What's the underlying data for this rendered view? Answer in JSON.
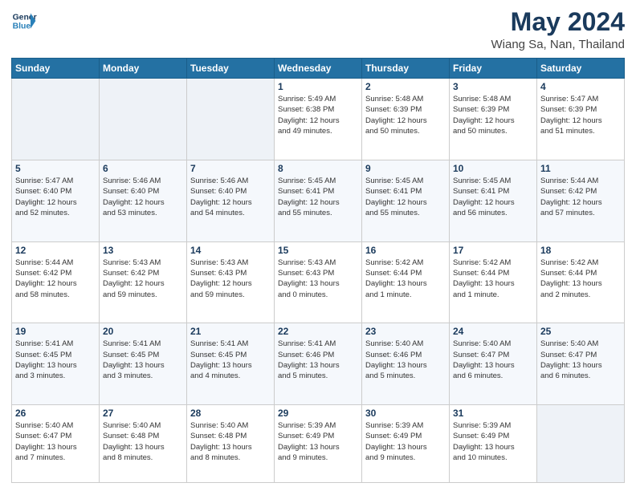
{
  "header": {
    "logo_line1": "General",
    "logo_line2": "Blue",
    "month": "May 2024",
    "location": "Wiang Sa, Nan, Thailand"
  },
  "weekdays": [
    "Sunday",
    "Monday",
    "Tuesday",
    "Wednesday",
    "Thursday",
    "Friday",
    "Saturday"
  ],
  "weeks": [
    [
      {
        "day": "",
        "info": ""
      },
      {
        "day": "",
        "info": ""
      },
      {
        "day": "",
        "info": ""
      },
      {
        "day": "1",
        "info": "Sunrise: 5:49 AM\nSunset: 6:38 PM\nDaylight: 12 hours\nand 49 minutes."
      },
      {
        "day": "2",
        "info": "Sunrise: 5:48 AM\nSunset: 6:39 PM\nDaylight: 12 hours\nand 50 minutes."
      },
      {
        "day": "3",
        "info": "Sunrise: 5:48 AM\nSunset: 6:39 PM\nDaylight: 12 hours\nand 50 minutes."
      },
      {
        "day": "4",
        "info": "Sunrise: 5:47 AM\nSunset: 6:39 PM\nDaylight: 12 hours\nand 51 minutes."
      }
    ],
    [
      {
        "day": "5",
        "info": "Sunrise: 5:47 AM\nSunset: 6:40 PM\nDaylight: 12 hours\nand 52 minutes."
      },
      {
        "day": "6",
        "info": "Sunrise: 5:46 AM\nSunset: 6:40 PM\nDaylight: 12 hours\nand 53 minutes."
      },
      {
        "day": "7",
        "info": "Sunrise: 5:46 AM\nSunset: 6:40 PM\nDaylight: 12 hours\nand 54 minutes."
      },
      {
        "day": "8",
        "info": "Sunrise: 5:45 AM\nSunset: 6:41 PM\nDaylight: 12 hours\nand 55 minutes."
      },
      {
        "day": "9",
        "info": "Sunrise: 5:45 AM\nSunset: 6:41 PM\nDaylight: 12 hours\nand 55 minutes."
      },
      {
        "day": "10",
        "info": "Sunrise: 5:45 AM\nSunset: 6:41 PM\nDaylight: 12 hours\nand 56 minutes."
      },
      {
        "day": "11",
        "info": "Sunrise: 5:44 AM\nSunset: 6:42 PM\nDaylight: 12 hours\nand 57 minutes."
      }
    ],
    [
      {
        "day": "12",
        "info": "Sunrise: 5:44 AM\nSunset: 6:42 PM\nDaylight: 12 hours\nand 58 minutes."
      },
      {
        "day": "13",
        "info": "Sunrise: 5:43 AM\nSunset: 6:42 PM\nDaylight: 12 hours\nand 59 minutes."
      },
      {
        "day": "14",
        "info": "Sunrise: 5:43 AM\nSunset: 6:43 PM\nDaylight: 12 hours\nand 59 minutes."
      },
      {
        "day": "15",
        "info": "Sunrise: 5:43 AM\nSunset: 6:43 PM\nDaylight: 13 hours\nand 0 minutes."
      },
      {
        "day": "16",
        "info": "Sunrise: 5:42 AM\nSunset: 6:44 PM\nDaylight: 13 hours\nand 1 minute."
      },
      {
        "day": "17",
        "info": "Sunrise: 5:42 AM\nSunset: 6:44 PM\nDaylight: 13 hours\nand 1 minute."
      },
      {
        "day": "18",
        "info": "Sunrise: 5:42 AM\nSunset: 6:44 PM\nDaylight: 13 hours\nand 2 minutes."
      }
    ],
    [
      {
        "day": "19",
        "info": "Sunrise: 5:41 AM\nSunset: 6:45 PM\nDaylight: 13 hours\nand 3 minutes."
      },
      {
        "day": "20",
        "info": "Sunrise: 5:41 AM\nSunset: 6:45 PM\nDaylight: 13 hours\nand 3 minutes."
      },
      {
        "day": "21",
        "info": "Sunrise: 5:41 AM\nSunset: 6:45 PM\nDaylight: 13 hours\nand 4 minutes."
      },
      {
        "day": "22",
        "info": "Sunrise: 5:41 AM\nSunset: 6:46 PM\nDaylight: 13 hours\nand 5 minutes."
      },
      {
        "day": "23",
        "info": "Sunrise: 5:40 AM\nSunset: 6:46 PM\nDaylight: 13 hours\nand 5 minutes."
      },
      {
        "day": "24",
        "info": "Sunrise: 5:40 AM\nSunset: 6:47 PM\nDaylight: 13 hours\nand 6 minutes."
      },
      {
        "day": "25",
        "info": "Sunrise: 5:40 AM\nSunset: 6:47 PM\nDaylight: 13 hours\nand 6 minutes."
      }
    ],
    [
      {
        "day": "26",
        "info": "Sunrise: 5:40 AM\nSunset: 6:47 PM\nDaylight: 13 hours\nand 7 minutes."
      },
      {
        "day": "27",
        "info": "Sunrise: 5:40 AM\nSunset: 6:48 PM\nDaylight: 13 hours\nand 8 minutes."
      },
      {
        "day": "28",
        "info": "Sunrise: 5:40 AM\nSunset: 6:48 PM\nDaylight: 13 hours\nand 8 minutes."
      },
      {
        "day": "29",
        "info": "Sunrise: 5:39 AM\nSunset: 6:49 PM\nDaylight: 13 hours\nand 9 minutes."
      },
      {
        "day": "30",
        "info": "Sunrise: 5:39 AM\nSunset: 6:49 PM\nDaylight: 13 hours\nand 9 minutes."
      },
      {
        "day": "31",
        "info": "Sunrise: 5:39 AM\nSunset: 6:49 PM\nDaylight: 13 hours\nand 10 minutes."
      },
      {
        "day": "",
        "info": ""
      }
    ]
  ]
}
